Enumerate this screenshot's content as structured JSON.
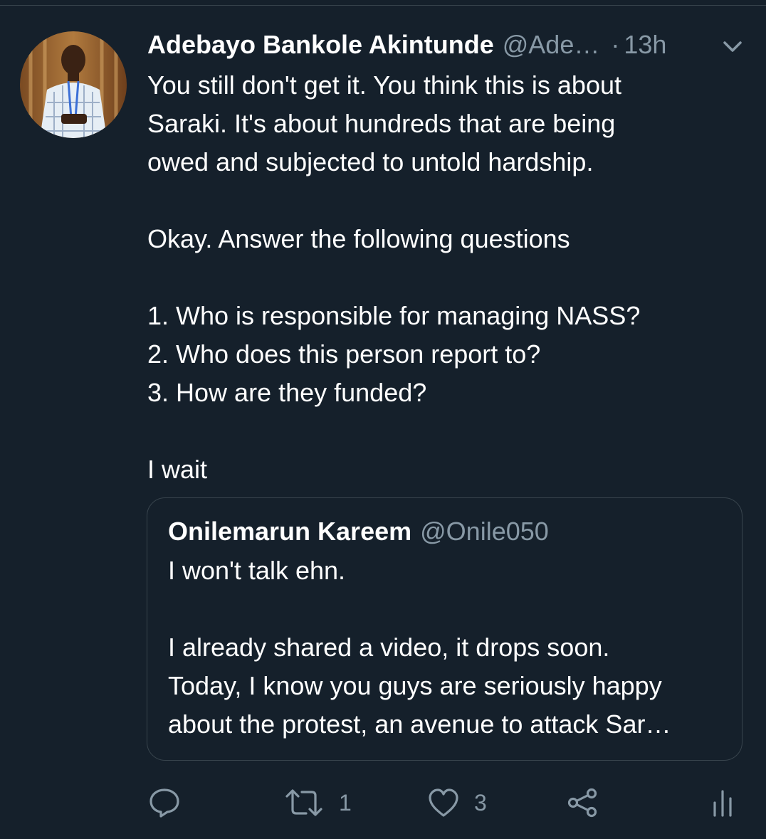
{
  "tweet": {
    "author_name": "Adebayo Bankole Akintunde",
    "author_handle": "@Ade…",
    "separator": "·",
    "time": "13h",
    "lines": [
      "You still don't get it.  You think this is about",
      "Saraki. It's about hundreds that are being",
      "owed and subjected to untold hardship.",
      "",
      "Okay. Answer the following questions",
      "",
      "1. Who is responsible for managing NASS?",
      "2. Who does this person report to?",
      "3. How are they funded?",
      "",
      "I wait"
    ]
  },
  "quoted_tweet": {
    "author_name": "Onilemarun Kareem",
    "author_handle": "@Onile050",
    "lines": [
      "I won't talk ehn.",
      "",
      "I already shared a video, it drops soon.",
      "Today, I know you guys are seriously happy",
      "about the protest, an avenue to attack Sar…"
    ]
  },
  "actions": {
    "reply_icon": "reply-icon",
    "retweet_icon": "retweet-icon",
    "retweet_count": "1",
    "like_icon": "heart-icon",
    "like_count": "3",
    "share_icon": "share-icon",
    "analytics_icon": "analytics-icon"
  },
  "colors": {
    "background": "#15202b",
    "text_primary": "#ffffff",
    "text_secondary": "#8899a6",
    "border": "#38444d"
  }
}
